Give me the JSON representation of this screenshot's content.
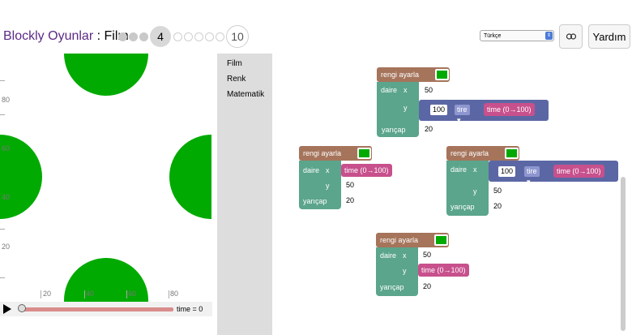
{
  "header": {
    "app_title": "Blockly Oyunlar",
    "separator": " : ",
    "game_title": "Film",
    "current_level": "4",
    "last_level": "10",
    "language": "Türkçe",
    "help_label": "Yardım"
  },
  "axes": {
    "v_labels": [
      "80",
      "60",
      "40",
      "20"
    ],
    "h_labels": [
      "20",
      "40",
      "60",
      "80"
    ]
  },
  "playback": {
    "time_label": "time = 0",
    "progress": 0
  },
  "toolbox": {
    "categories": [
      "Film",
      "Renk",
      "Matematik"
    ]
  },
  "blocks": {
    "set_color": "rengi ayarla",
    "circle": "daire",
    "x": "x",
    "y": "y",
    "radius": "yarıçap",
    "op": "tire",
    "time": "time (0→100)",
    "b1": {
      "x": "50",
      "y_num": "100",
      "r": "20"
    },
    "b2": {
      "y": "50",
      "r": "20"
    },
    "b3": {
      "x_num": "100",
      "y": "50",
      "r": "20"
    },
    "b4": {
      "x": "50",
      "r": "20"
    }
  },
  "colors": {
    "circle_fill": "#00aa00",
    "block_color": "#a5745b",
    "block_circle": "#5ba58c",
    "block_math": "#5b67a5",
    "block_time": "#c7508d"
  }
}
